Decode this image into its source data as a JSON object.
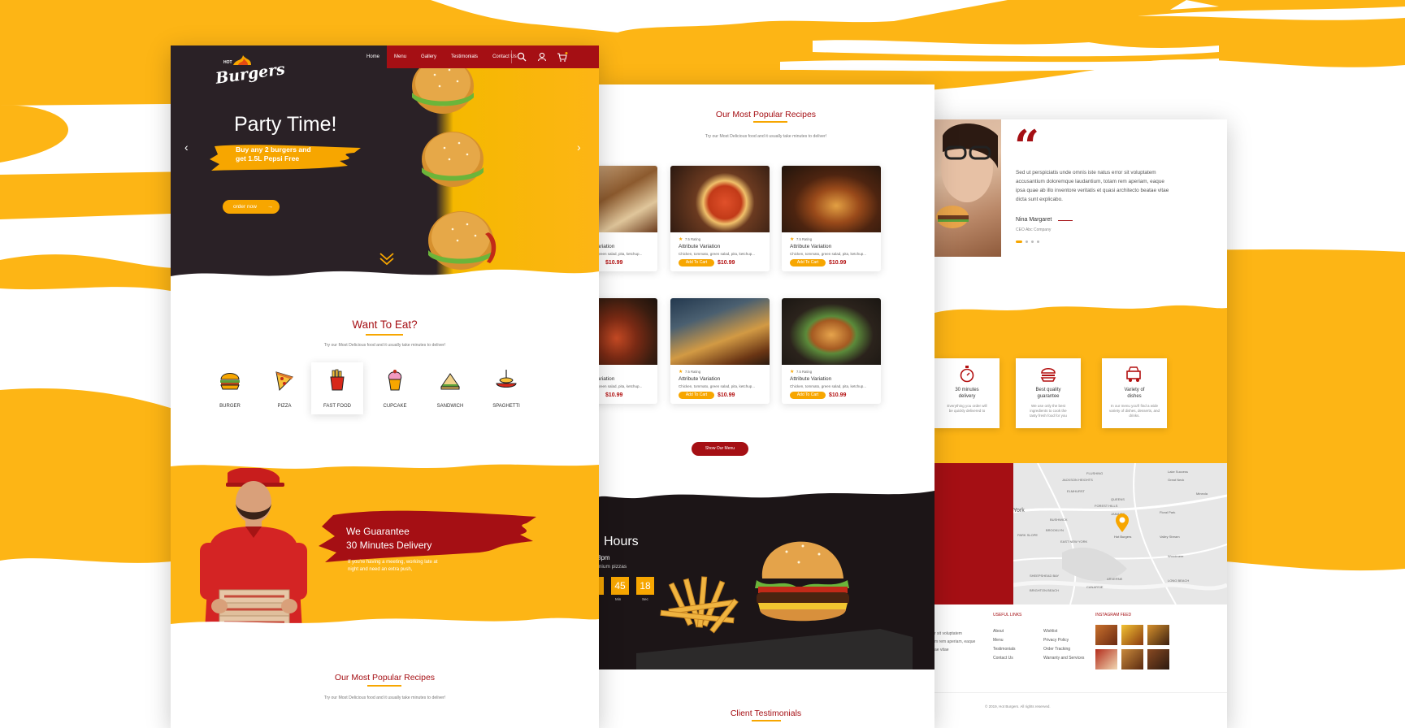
{
  "colors": {
    "brand_yellow": "#fdb515",
    "brand_red": "#a50f14",
    "dark": "#2a2126"
  },
  "nav": {
    "logo_small": "HOT",
    "logo_main": "Burgers",
    "items": [
      "Home",
      "Menu",
      "Gallery",
      "Testimonials",
      "Contact Us"
    ],
    "icons": [
      "search-icon",
      "user-icon",
      "cart-icon"
    ]
  },
  "hero": {
    "title": "Party Time!",
    "subtitle_line1": "Buy any 2 burgers and",
    "subtitle_line2": "get 1.5L Pepsi Free",
    "cta": "order now"
  },
  "want_to_eat": {
    "title": "Want To Eat?",
    "subtitle": "Try our Most Delicious food and it usually take minutes to deliver!",
    "categories": [
      "BURGER",
      "PIZZA",
      "FAST FOOD",
      "CUPCAKE",
      "SANDWICH",
      "SPAGHETTI"
    ]
  },
  "delivery": {
    "title_line1": "We Guarantee",
    "title_line2": "30 Minutes Delivery",
    "text_line1": "If you're having a meeting, working late at",
    "text_line2": "night and need an extra push,"
  },
  "popular_bottom": {
    "title": "Our Most Popular Recipes",
    "subtitle": "Try our Most Delicious food and it usually take minutes to deliver!"
  },
  "popular": {
    "title": "Our Most Popular Recipes",
    "subtitle": "Try our Most Delicious food and it usually take minutes to deliver!",
    "cards": [
      {
        "rating": "7.5 Rating",
        "name": "ariation",
        "desc": "green salad, pita, ketchup...",
        "price": "$10.99",
        "btn": "Add To Cart"
      },
      {
        "rating": "7.5 Rating",
        "name": "Attribute Variation",
        "desc": "Chicken, tommato, green salad, pita, ketchup...",
        "price": "$10.99",
        "btn": "Add To Cart"
      },
      {
        "rating": "7.5 Rating",
        "name": "Attribute Variation",
        "desc": "Chicken, tommato, green salad, pita, ketchup...",
        "price": "$10.99",
        "btn": "Add To Cart"
      },
      {
        "rating": "7.5 Rating",
        "name": "ariation",
        "desc": "green salad, pita, ketchup...",
        "price": "$10.99",
        "btn": "Add To Cart"
      },
      {
        "rating": "7.5 Rating",
        "name": "Attribute Variation",
        "desc": "Chicken, tommato, green salad, pita, ketchup...",
        "price": "$10.99",
        "btn": "Add To Cart"
      },
      {
        "rating": "7.5 Rating",
        "name": "Attribute Variation",
        "desc": "Chicken, tommato, green salad, pita, ketchup...",
        "price": "$10.99",
        "btn": "Add To Cart"
      }
    ],
    "show_menu": "Show Our Menu"
  },
  "happy_hours": {
    "title": "Hours",
    "line1": "8pm",
    "line2": "mium pizzas",
    "count_min": "45",
    "count_sec": "18",
    "lbl_min": "Min",
    "lbl_sec": "Sec"
  },
  "client_testimonials": {
    "title": "Client Testimonials"
  },
  "testimonial": {
    "quote_mark": "“",
    "text_lines": [
      "Sed ut perspiciatis unde omnis iste natus error sit voluptatem",
      "accusantium doloremque laudantium, totam rem aperiam, eaque",
      "ipsa quae ab illo inventore veritatis et quasi architecto beatae vitae",
      "dicta sunt explicabo."
    ],
    "name": "Nina Margaret",
    "role": "CEO Abc Company"
  },
  "services": [
    {
      "icon": "stopwatch-icon",
      "title_line1": "30 minutes",
      "title_line2": "delivery",
      "text_line1": "Everything you order will",
      "text_line2": "be quickly delivered to"
    },
    {
      "icon": "burger-icon",
      "title_line1": "Best quality",
      "title_line2": "guarantee",
      "text_line1": "We use only the best",
      "text_line2": "ingredients to cook the",
      "text_line3": "tasty fresh food for you"
    },
    {
      "icon": "food-truck-icon",
      "title_line1": "Variety of",
      "title_line2": "dishes",
      "text_line1": "In our menu you'll find a wide",
      "text_line2": "variety of dishes, desserts, and",
      "text_line3": "drinks."
    }
  ],
  "map": {
    "labels": [
      "York",
      "FLUSHING",
      "JACKSON HEIGHTS",
      "ELMHURST",
      "QUEENS",
      "Lake Success",
      "Great Neck",
      "Mineola",
      "FOREST HILLS",
      "JAMAICA",
      "Floral Park",
      "BUSHWICK",
      "BROOKLYN",
      "PARK SLOPE",
      "EAST NEW YORK",
      "Valley Stream",
      "Woodmere",
      "SHEEPSHEAD BAY",
      "BRIGHTON BEACH",
      "CANARSIE",
      "ARVERNE",
      "LONG BEACH"
    ],
    "pin_label": "Hot Burgers"
  },
  "footer": {
    "about_lines": [
      "r sit voluptatem",
      "m rem aperiam, eaque",
      "ae vitae"
    ],
    "useful_title": "USEFUL LINKS",
    "useful_col1": [
      "About",
      "Menu",
      "Testimonials",
      "Contact Us"
    ],
    "useful_col2": [
      "Wishlist",
      "Privacy Policy",
      "Order Tracking",
      "Warranty and Services"
    ],
    "insta_title": "INSTAGRAM FEED",
    "copyright": "© 2019, Hot Burgers. All rights reserved."
  }
}
